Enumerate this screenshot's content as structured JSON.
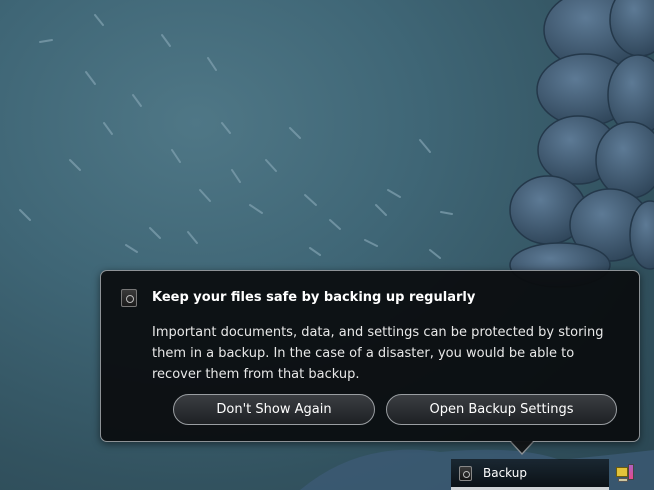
{
  "notification": {
    "icon": "backup-safe-icon",
    "title": "Keep your files safe by backing up regularly",
    "body": "Important documents, data, and settings can be protected by storing them in a backup. In the case of a disaster, you would be able to recover them from that backup.",
    "buttons": {
      "dismiss_label": "Don't Show Again",
      "open_label": "Open Backup Settings"
    }
  },
  "panel": {
    "tray_item_label": "Backup",
    "tray_item_icon": "backup-safe-icon",
    "system_icon": "power-display-icon"
  },
  "colors": {
    "background": "#3f6676",
    "bubble": "#0a0c0e",
    "bubble_border": "#8d9296"
  }
}
